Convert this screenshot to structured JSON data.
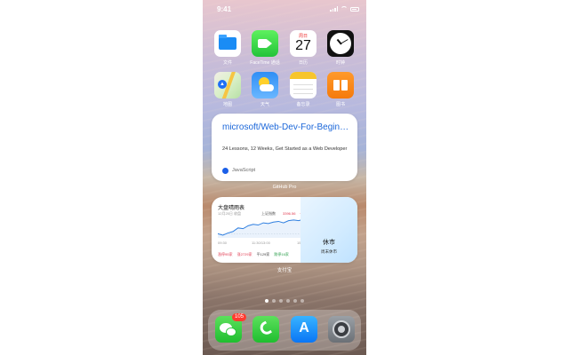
{
  "status_bar": {
    "time": "9:41"
  },
  "apps": {
    "files": "文件",
    "facetime": "FaceTime 通话",
    "calendar": "日历",
    "calendar_day": "周日",
    "calendar_date": "27",
    "clock": "时钟",
    "maps": "地图",
    "weather": "天气",
    "notes": "备忘录",
    "books": "图书"
  },
  "github_widget": {
    "title": "microsoft/Web-Dev-For-Beginners",
    "description": "24 Lessons, 12 Weeks, Get Started as a Web Developer",
    "language": "JavaScript",
    "language_color": "#1b5fe8",
    "caption": "GitHub Pro"
  },
  "stock_widget": {
    "title": "大盘晴雨表",
    "date": "12月25日 收盘",
    "index_name": "上证指数",
    "index_value": "3396.56",
    "change_pct": "+0.49%",
    "time_labels": [
      "09:30",
      "11:30/13:00",
      "15:00"
    ],
    "breadth": {
      "up_stop": "涨停95家",
      "up": "涨2729家",
      "flat": "平129家",
      "down": "跌停16家"
    },
    "market_status": "休市",
    "market_status_sub": "周末休市",
    "caption": "支付宝",
    "chart_data": {
      "type": "line",
      "series": [
        {
          "values": [
            3377,
            3375,
            3378,
            3380,
            3385,
            3384,
            3388,
            3390,
            3389,
            3392,
            3391,
            3393,
            3394,
            3392,
            3395,
            3396,
            3395,
            3397,
            3396,
            3396.56
          ]
        }
      ],
      "xlabels": [
        "09:30",
        "11:30/13:00",
        "15:00"
      ]
    }
  },
  "page_dots": {
    "count": 6,
    "active": 0
  },
  "dock": {
    "wechat_badge": "105",
    "apps": [
      "wechat",
      "phone",
      "app-store",
      "settings"
    ]
  },
  "colors": {
    "accent_blue": "#1a66d9",
    "up_red": "#e0374d",
    "down_green": "#2a9d4a",
    "badge_red": "#ff3b30"
  }
}
